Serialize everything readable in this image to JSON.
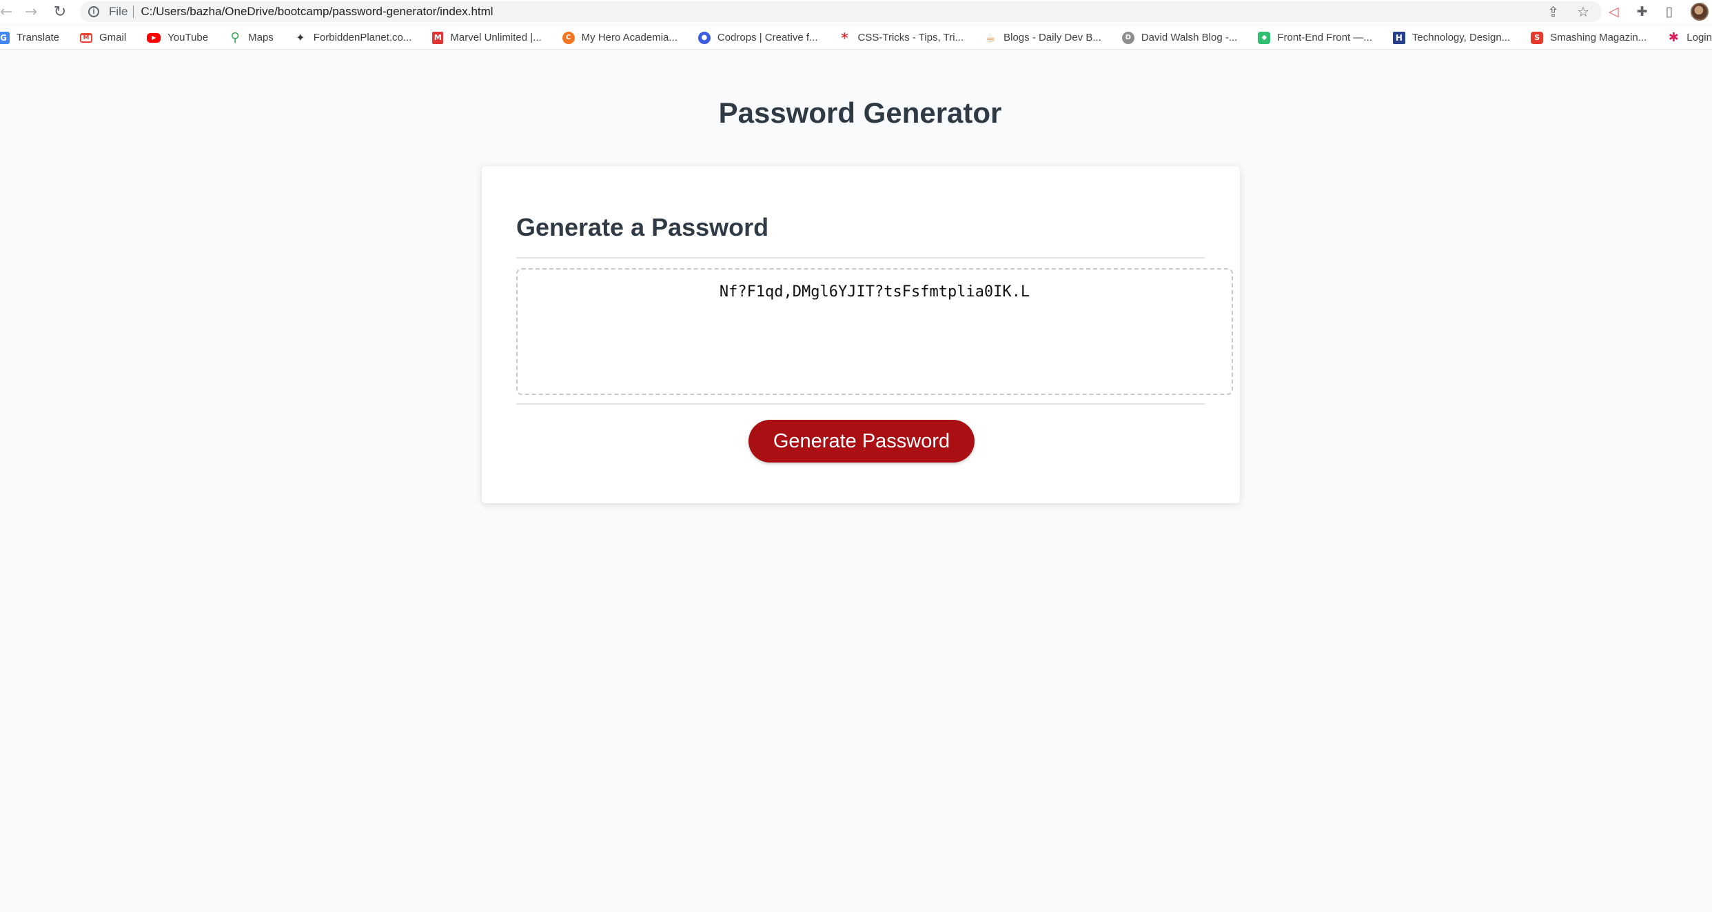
{
  "browser": {
    "scheme_label": "File",
    "url": "C:/Users/bazha/OneDrive/bootcamp/password-generator/index.html",
    "icons": [
      "back-arrow-icon",
      "forward-arrow-icon",
      "reload-icon",
      "info-icon",
      "share-icon",
      "star-icon",
      "extension-record-icon",
      "puzzle-icon",
      "side-panel-icon",
      "avatar"
    ]
  },
  "bookmarks": [
    {
      "label": "Translate",
      "icon": "translate-icon"
    },
    {
      "label": "Gmail",
      "icon": "gmail-icon"
    },
    {
      "label": "YouTube",
      "icon": "youtube-icon"
    },
    {
      "label": "Maps",
      "icon": "maps-icon"
    },
    {
      "label": "ForbiddenPlanet.co...",
      "icon": "forbidden-planet-icon"
    },
    {
      "label": "Marvel Unlimited |...",
      "icon": "marvel-icon"
    },
    {
      "label": "My Hero Academia...",
      "icon": "crunchyroll-icon"
    },
    {
      "label": "Codrops | Creative f...",
      "icon": "codrops-icon"
    },
    {
      "label": "CSS-Tricks - Tips, Tri...",
      "icon": "css-tricks-icon"
    },
    {
      "label": "Blogs - Daily Dev B...",
      "icon": "blogs-icon"
    },
    {
      "label": "David Walsh Blog -...",
      "icon": "david-walsh-icon"
    },
    {
      "label": "Front-End Front —...",
      "icon": "front-end-front-icon"
    },
    {
      "label": "Technology, Design...",
      "icon": "technology-icon"
    },
    {
      "label": "Smashing Magazin...",
      "icon": "smashing-icon"
    },
    {
      "label": "Login | Slack",
      "icon": "slack-icon"
    }
  ],
  "page": {
    "title": "Password Generator",
    "card_header": "Generate a Password",
    "password": "Nf?F1qd,DMgl6YJIT?tsFsfmtplia0IK.L",
    "button_label": "Generate Password",
    "button_color": "#a90f13"
  }
}
